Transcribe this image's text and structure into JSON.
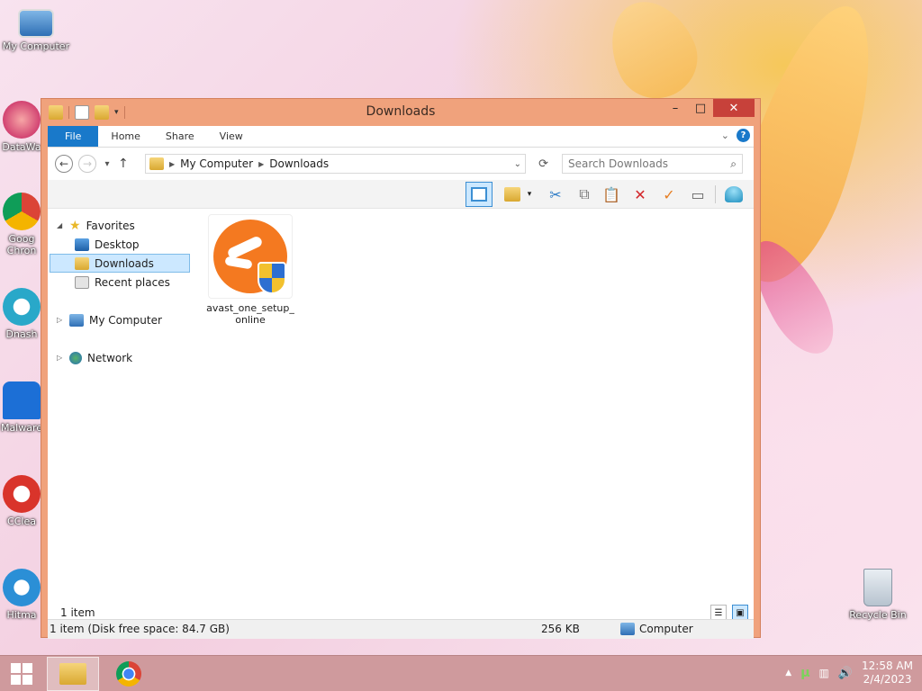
{
  "desktop": {
    "icons": [
      {
        "label": "My Computer"
      },
      {
        "label": "DataWa"
      },
      {
        "label": "Goog Chron"
      },
      {
        "label": "Dnash"
      },
      {
        "label": "Malware"
      },
      {
        "label": "CClea"
      },
      {
        "label": "Hitma"
      },
      {
        "label": "Recycle Bin"
      }
    ]
  },
  "window": {
    "title": "Downloads",
    "controls": {
      "minimize": "–",
      "maximize": "□",
      "close": "✕"
    }
  },
  "ribbon": {
    "tabs": [
      "File",
      "Home",
      "Share",
      "View"
    ],
    "help": "?"
  },
  "address": {
    "path": [
      "My Computer",
      "Downloads"
    ],
    "search_placeholder": "Search Downloads"
  },
  "navpane": {
    "favorites": "Favorites",
    "desktop": "Desktop",
    "downloads": "Downloads",
    "recent": "Recent places",
    "computer": "My Computer",
    "network": "Network"
  },
  "content": {
    "file": {
      "name": "avast_one_setup_online"
    }
  },
  "status": {
    "count": "1 item",
    "summary": "1 item (Disk free space: 84.7 GB)",
    "size": "256 KB",
    "location": "Computer"
  },
  "taskbar": {
    "time": "12:58 AM",
    "date": "2/4/2023"
  },
  "colors": {
    "window_frame": "#f0a27c",
    "file_tab": "#1979ca",
    "selection": "#cce8ff",
    "taskbar": "#cf9a9d",
    "avast_orange": "#f47920"
  }
}
